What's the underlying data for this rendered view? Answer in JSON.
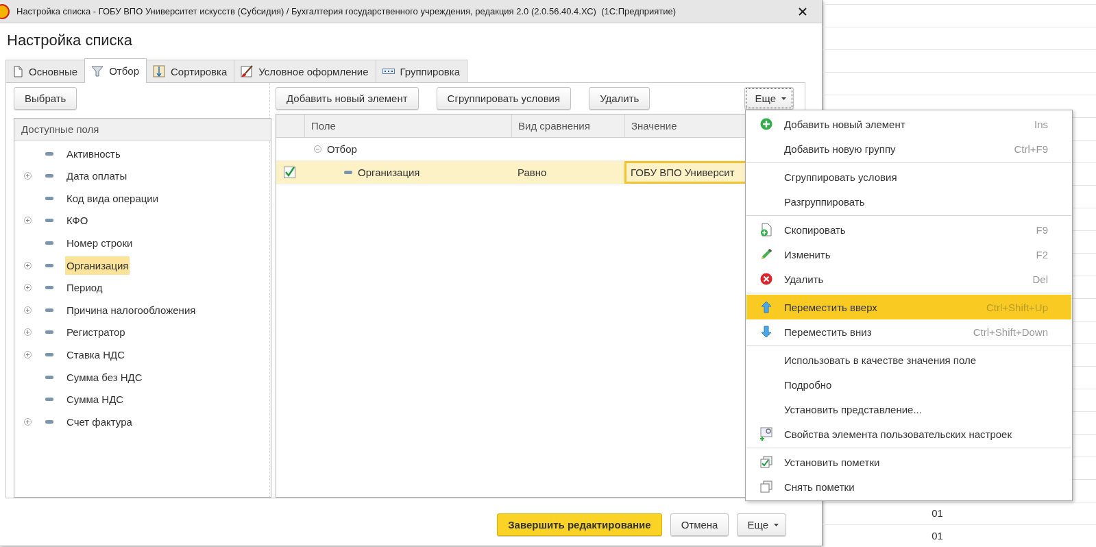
{
  "window": {
    "title": "Настройка списка - ГОБУ ВПО Университет искусств (Субсидия) / Бухгалтерия государственного учреждения, редакция 2.0 (2.0.56.40.4.ХС)  (1С:Предприятие)"
  },
  "heading": "Настройка списка",
  "tabs": [
    {
      "label": "Основные",
      "kind": "page",
      "selected": false
    },
    {
      "label": "Отбор",
      "kind": "funnel",
      "selected": true
    },
    {
      "label": "Сортировка",
      "kind": "sort",
      "selected": false
    },
    {
      "label": "Условное оформление",
      "kind": "brush",
      "selected": false
    },
    {
      "label": "Группировка",
      "kind": "group",
      "selected": false
    }
  ],
  "available_fields": {
    "select_button": "Выбрать",
    "header": "Доступные поля",
    "items": [
      {
        "label": "Активность",
        "expandable": false,
        "selected": false
      },
      {
        "label": "Дата оплаты",
        "expandable": true,
        "selected": false
      },
      {
        "label": "Код вида операции",
        "expandable": false,
        "selected": false
      },
      {
        "label": "КФО",
        "expandable": true,
        "selected": false
      },
      {
        "label": "Номер строки",
        "expandable": false,
        "selected": false
      },
      {
        "label": "Организация",
        "expandable": true,
        "selected": true
      },
      {
        "label": "Период",
        "expandable": true,
        "selected": false
      },
      {
        "label": "Причина налогообложения",
        "expandable": true,
        "selected": false
      },
      {
        "label": "Регистратор",
        "expandable": true,
        "selected": false
      },
      {
        "label": "Ставка НДС",
        "expandable": true,
        "selected": false
      },
      {
        "label": "Сумма без НДС",
        "expandable": false,
        "selected": false
      },
      {
        "label": "Сумма НДС",
        "expandable": false,
        "selected": false
      },
      {
        "label": "Счет фактура",
        "expandable": true,
        "selected": false
      }
    ]
  },
  "filter": {
    "buttons": [
      "Добавить новый элемент",
      "Сгруппировать условия",
      "Удалить"
    ],
    "more_button": {
      "label": "Еще",
      "pressed": true
    },
    "columns": [
      "Поле",
      "Вид сравнения",
      "Значение"
    ],
    "rows": [
      {
        "field": "Отбор",
        "expanded": true,
        "children": [
          {
            "field": "Организация",
            "checked": true,
            "comparison": "Равно",
            "value": "ГОБУ ВПО Университ",
            "selected": true
          }
        ]
      }
    ]
  },
  "context_menu": {
    "groups": [
      {
        "items": [
          {
            "label": "Добавить новый элемент",
            "kind": "plus",
            "shortcut": "Ins",
            "selected": false
          },
          {
            "label": "Добавить новую группу",
            "shortcut": "Ctrl+F9",
            "selected": false
          }
        ]
      },
      {
        "items": [
          {
            "label": "Сгруппировать условия",
            "selected": false
          },
          {
            "label": "Разгруппировать",
            "selected": false
          }
        ]
      },
      {
        "items": [
          {
            "label": "Скопировать",
            "kind": "copy",
            "shortcut": "F9",
            "selected": false
          },
          {
            "label": "Изменить",
            "kind": "pencil",
            "shortcut": "F2",
            "selected": false
          },
          {
            "label": "Удалить",
            "kind": "delete",
            "shortcut": "Del",
            "selected": false
          }
        ]
      },
      {
        "items": [
          {
            "label": "Переместить вверх",
            "kind": "up",
            "shortcut": "Ctrl+Shift+Up",
            "selected": true
          },
          {
            "label": "Переместить вниз",
            "kind": "down",
            "shortcut": "Ctrl+Shift+Down",
            "selected": false
          }
        ]
      },
      {
        "items": [
          {
            "label": "Использовать в качестве значения поле",
            "selected": false
          },
          {
            "label": "Подробно",
            "selected": false
          },
          {
            "label": "Установить представление...",
            "selected": false
          },
          {
            "label": "Свойства элемента пользовательских настроек",
            "kind": "props",
            "selected": false
          }
        ]
      },
      {
        "items": [
          {
            "label": "Установить пометки",
            "kind": "check-all",
            "selected": false
          },
          {
            "label": "Снять пометки",
            "kind": "uncheck-all",
            "selected": false
          }
        ]
      }
    ]
  },
  "footer_buttons": [
    {
      "label": "Завершить редактирование",
      "kind": "primary"
    },
    {
      "label": "Отмена",
      "kind": "normal"
    },
    {
      "label": "Еще",
      "kind": "dropdown"
    }
  ],
  "background_rows": [
    {
      "column_1": "01"
    },
    {
      "column_1": "01"
    }
  ]
}
